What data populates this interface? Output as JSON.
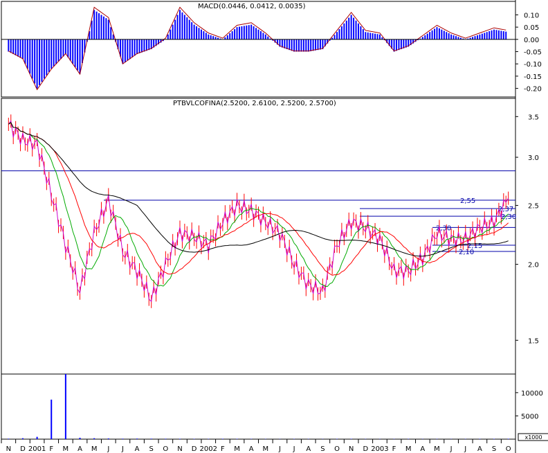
{
  "macd_panel": {
    "title": "MACD(0.0446, 0.0412, 0.0035)",
    "yticks": [
      "0.10",
      "0.05",
      "0.00",
      "-0.05",
      "-0.10",
      "-0.15",
      "-0.20"
    ],
    "ytick_values": [
      0.1,
      0.05,
      0.0,
      -0.05,
      -0.1,
      -0.15,
      -0.2
    ],
    "ylim": [
      -0.235,
      0.155
    ]
  },
  "price_panel": {
    "title": "PTBVLCOFINA(2.5200, 2.6100, 2.5200, 2.5700)",
    "yticks": [
      "3.5",
      "3.0",
      "2.5",
      "2.0",
      "1.5"
    ],
    "ytick_values": [
      3.5,
      3.0,
      2.5,
      2.0,
      1.5
    ],
    "ylim": [
      1.32,
      3.75
    ],
    "scale": "log",
    "level_labels": [
      "2,55",
      "2,37",
      "2,30",
      "2,30",
      "2,15",
      "2,10"
    ]
  },
  "volume_panel": {
    "yticks": [
      "10000",
      "5000"
    ],
    "ytick_values": [
      10000,
      5000
    ],
    "ylim": [
      0,
      14000
    ],
    "unit_label": "x1000"
  },
  "x_axis": {
    "labels": [
      "N",
      "D",
      "2001",
      "F",
      "M",
      "A",
      "M",
      "J",
      "J",
      "A",
      "S",
      "O",
      "N",
      "D",
      "2002",
      "F",
      "M",
      "A",
      "M",
      "J",
      "J",
      "A",
      "S",
      "O",
      "N",
      "D",
      "2003",
      "F",
      "M",
      "A",
      "M",
      "J",
      "J",
      "A",
      "S",
      "O"
    ]
  },
  "colors": {
    "macd_hist": "#0000ff",
    "price": "#ff0000",
    "ma_short": "#00aa00",
    "ma_mid": "#ff0000",
    "ma_long": "#000000",
    "levels": "#0000aa",
    "grid": "#000000"
  },
  "chart_data": {
    "type": "line",
    "title": "PTBVLCOFINA(2.5200, 2.6100, 2.5200, 2.5700)",
    "x": [
      "N",
      "D",
      "2001",
      "F",
      "M",
      "A",
      "M",
      "J",
      "J",
      "A",
      "S",
      "O",
      "N",
      "D",
      "2002",
      "F",
      "M",
      "A",
      "M",
      "J",
      "J",
      "A",
      "S",
      "O",
      "N",
      "D",
      "2003",
      "F",
      "M",
      "A",
      "M",
      "J",
      "J",
      "A",
      "S",
      "O"
    ],
    "series": [
      {
        "values": [
          3.4,
          3.2,
          3.15,
          2.6,
          2.15,
          1.8,
          2.25,
          2.55,
          2.1,
          1.95,
          1.75,
          2.0,
          2.25,
          2.22,
          2.15,
          2.35,
          2.5,
          2.45,
          2.35,
          2.25,
          2.0,
          1.85,
          1.8,
          2.15,
          2.35,
          2.3,
          2.2,
          1.95,
          1.95,
          2.05,
          2.25,
          2.2,
          2.2,
          2.3,
          2.35,
          2.57
        ]
      }
    ],
    "ylim": [
      1.32,
      3.75
    ],
    "levels": [
      2.85,
      2.55,
      2.47,
      2.4,
      2.3,
      2.15,
      2.1
    ],
    "macd": [
      -0.05,
      -0.08,
      -0.2,
      -0.12,
      -0.06,
      -0.14,
      0.12,
      0.08,
      -0.1,
      -0.06,
      -0.04,
      0.0,
      0.12,
      0.06,
      0.02,
      0.0,
      0.05,
      0.06,
      0.02,
      -0.03,
      -0.05,
      -0.05,
      -0.04,
      0.03,
      0.1,
      0.03,
      0.02,
      -0.05,
      -0.03,
      0.01,
      0.05,
      0.02,
      0.0,
      0.02,
      0.04,
      0.03
    ],
    "volume": [
      100,
      200,
      500,
      8500,
      14000,
      300,
      200,
      150,
      100,
      120,
      100,
      90,
      80,
      70,
      60,
      80,
      70,
      60,
      50,
      40,
      60,
      50,
      40,
      60,
      70,
      50,
      40,
      50,
      60,
      40,
      50,
      40,
      50,
      60,
      70,
      80
    ]
  }
}
